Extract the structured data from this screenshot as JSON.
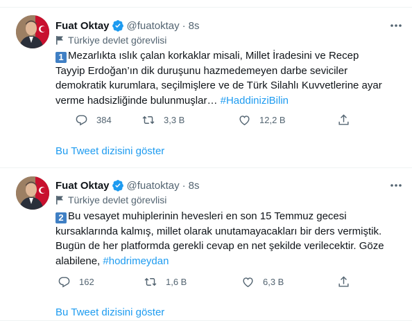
{
  "tweets": [
    {
      "name": "Fuat Oktay",
      "handle": "@fuatoktay",
      "separator": "·",
      "time": "8s",
      "label": "Türkiye devlet görevlisi",
      "badge": "1",
      "text": "Mezarlıkta ıslık çalan korkaklar misali, Millet İradesini ve Recep Tayyip Erdoğan’ın dik duruşunu hazmedemeyen darbe seviciler demokratik kurumlara, seçilmişlere ve de Türk Silahlı Kuvvetlerine ayar verme hadsizliğinde bulunmuşlar… ",
      "hashtag": "#HaddiniziBilin",
      "replies": "384",
      "retweets": "3,3 B",
      "likes": "12,2 B",
      "thread_link": "Bu Tweet dizisini göster"
    },
    {
      "name": "Fuat Oktay",
      "handle": "@fuatoktay",
      "separator": "·",
      "time": "8s",
      "label": "Türkiye devlet görevlisi",
      "badge": "2",
      "text": "Bu vesayet muhiplerinin hevesleri en son 15 Temmuz gecesi kursaklarında kalmış, millet olarak unutamayacakları bir ders vermiştik. Bugün de her platformda gerekli cevap en net şekilde verilecektir. Göze alabilene, ",
      "hashtag": "#hodrimeydan",
      "replies": "162",
      "retweets": "1,6 B",
      "likes": "6,3 B",
      "thread_link": "Bu Tweet dizisini göster"
    }
  ],
  "colors": {
    "accent": "#1d9bf0",
    "secondary_text": "#536471",
    "badge": "#3f7fc4"
  },
  "icons": [
    "verified-badge-icon",
    "flag-icon",
    "more-icon",
    "reply-icon",
    "retweet-icon",
    "like-icon",
    "share-icon"
  ]
}
